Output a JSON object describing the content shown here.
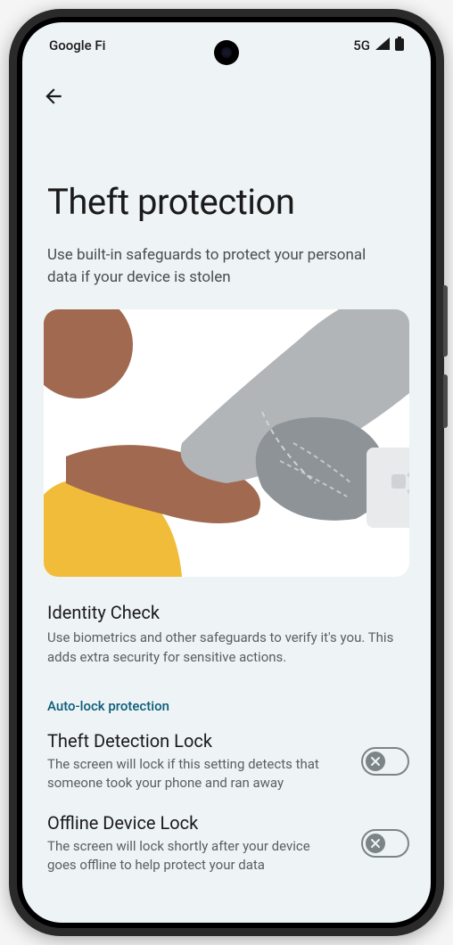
{
  "status_bar": {
    "carrier": "Google Fi",
    "network": "5G"
  },
  "page": {
    "title": "Theft protection",
    "subtitle": "Use built-in safeguards to protect your personal data if your device is stolen"
  },
  "identity_check": {
    "title": "Identity Check",
    "desc": "Use biometrics and other safeguards to verify it's you. This adds extra security for sensitive actions."
  },
  "subsection_header": "Auto-lock protection",
  "theft_detection": {
    "title": "Theft Detection Lock",
    "desc": "The screen will lock if this setting detects that someone took your phone and ran away"
  },
  "offline_lock": {
    "title": "Offline Device Lock",
    "desc": "The screen will lock shortly after your device goes offline to help protect your data"
  }
}
